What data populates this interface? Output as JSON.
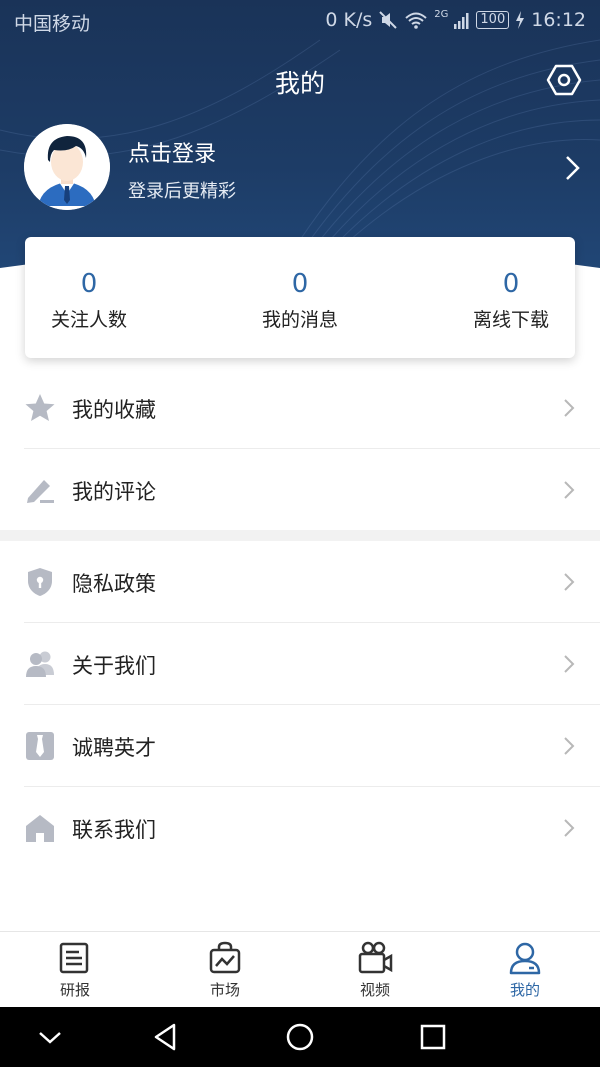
{
  "status_bar": {
    "carrier": "中国移动",
    "speed": "0 K/s",
    "network": "2G",
    "battery": "100",
    "time": "16:12"
  },
  "header": {
    "title": "我的",
    "settings_icon": "settings-hexagon-icon"
  },
  "profile": {
    "login_title": "点击登录",
    "login_subtitle": "登录后更精彩",
    "avatar_icon": "user-avatar-icon"
  },
  "stats": [
    {
      "value": "0",
      "label": "关注人数"
    },
    {
      "value": "0",
      "label": "我的消息"
    },
    {
      "value": "0",
      "label": "离线下载"
    }
  ],
  "menu_group_1": [
    {
      "label": "我的收藏",
      "icon": "star-icon"
    },
    {
      "label": "我的评论",
      "icon": "edit-pen-icon"
    }
  ],
  "menu_group_2": [
    {
      "label": "隐私政策",
      "icon": "shield-icon"
    },
    {
      "label": "关于我们",
      "icon": "users-icon"
    },
    {
      "label": "诚聘英才",
      "icon": "tie-icon"
    },
    {
      "label": "联系我们",
      "icon": "home-icon"
    }
  ],
  "tabs": [
    {
      "label": "研报",
      "icon": "report-icon",
      "active": false
    },
    {
      "label": "市场",
      "icon": "market-bag-icon",
      "active": false
    },
    {
      "label": "视频",
      "icon": "video-camera-icon",
      "active": false
    },
    {
      "label": "我的",
      "icon": "profile-icon",
      "active": true
    }
  ],
  "colors": {
    "header_dark": "#1a3358",
    "accent": "#2e67a5",
    "icon_grey": "#b6bac4"
  }
}
